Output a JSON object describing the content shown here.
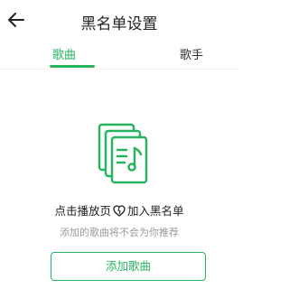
{
  "header": {
    "title": "黑名单设置",
    "back_icon": "arrow-left-icon"
  },
  "tabs": [
    {
      "label": "歌曲",
      "active": true
    },
    {
      "label": "歌手",
      "active": false
    }
  ],
  "empty_state": {
    "illustration_icon": "music-documents-icon",
    "hint_prefix": "点击播放页",
    "hint_icon": "heart-broken-icon",
    "hint_suffix": "加入黑名单",
    "sub_text": "添加的歌曲将不会为你推荐",
    "add_button_label": "添加歌曲"
  },
  "colors": {
    "accent": "#27b35f",
    "muted_text": "#9a9a9a"
  }
}
